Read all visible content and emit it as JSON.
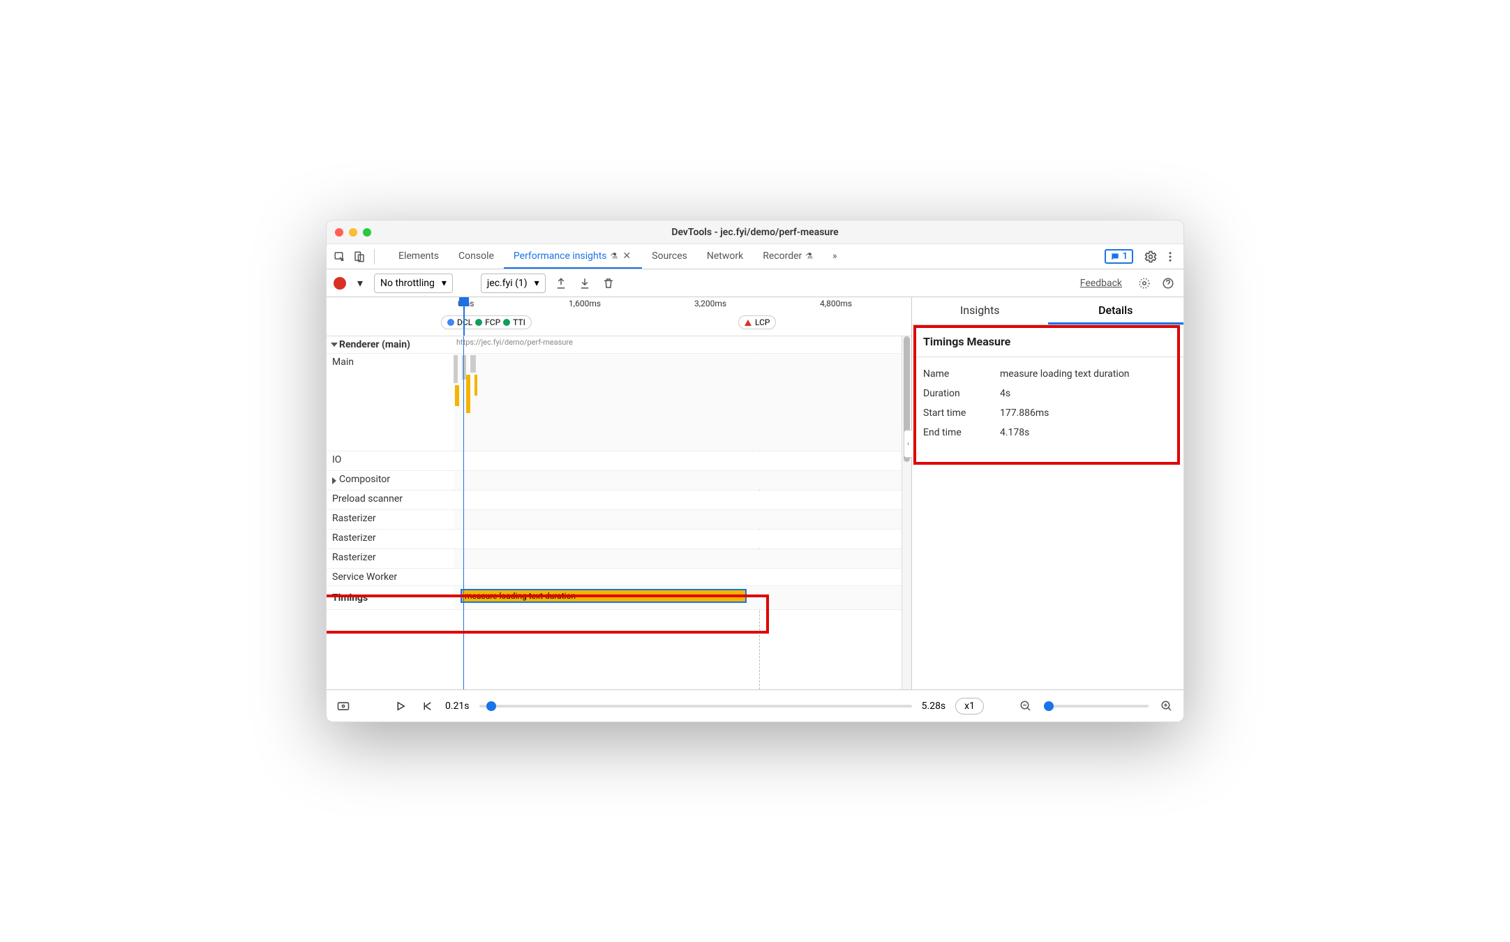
{
  "window": {
    "title": "DevTools - jec.fyi/demo/perf-measure"
  },
  "tabs": {
    "items": [
      "Elements",
      "Console",
      "Performance insights",
      "Sources",
      "Network",
      "Recorder"
    ],
    "active": "Performance insights",
    "experiment_suffix": true,
    "overflow_count": 1
  },
  "chat_badge": "1",
  "toolbar": {
    "throttle": "No throttling",
    "page_select": "jec.fyi (1)",
    "feedback": "Feedback"
  },
  "ruler": {
    "ticks": [
      "0ms",
      "1,600ms",
      "3,200ms",
      "4,800ms"
    ],
    "markers": [
      "DCL",
      "FCP",
      "TTI"
    ],
    "lcp": "LCP"
  },
  "tracks": {
    "renderer": "Renderer (main)",
    "rows": [
      "Main",
      "IO",
      "Compositor",
      "Preload scanner",
      "Rasterizer",
      "Rasterizer",
      "Rasterizer",
      "Service Worker"
    ],
    "timings_label": "Timings",
    "timings_bar": "measure loading text duration",
    "url_hint": "https://jec.fyi/demo/perf-measure"
  },
  "right": {
    "tabs": [
      "Insights",
      "Details"
    ],
    "section_title": "Timings Measure",
    "rows": [
      {
        "k": "Name",
        "v": "measure loading text duration"
      },
      {
        "k": "Duration",
        "v": "4s"
      },
      {
        "k": "Start time",
        "v": "177.886ms"
      },
      {
        "k": "End time",
        "v": "4.178s"
      }
    ]
  },
  "footer": {
    "start": "0.21s",
    "end": "5.28s",
    "zoom": "x1"
  }
}
